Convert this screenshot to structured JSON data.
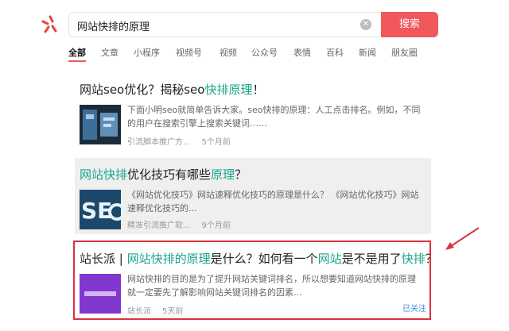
{
  "search": {
    "query": "网站快排的原理",
    "button_label": "搜索"
  },
  "tabs": [
    "全部",
    "文章",
    "小程序",
    "视频号",
    "视频",
    "公众号",
    "表情",
    "百科",
    "新闻",
    "朋友圈"
  ],
  "results": [
    {
      "title_plain_a": "网站seo优化？揭秘seo",
      "title_green": "快排原理",
      "title_plain_b": "！",
      "snippet": "下面小明seo就简单告诉大家。seo快排的原理：人工点击排名。例如，不同的用户在搜索引擎上搜索关键词……",
      "source": "引流脚本推广方...",
      "time": "5个月前"
    },
    {
      "title_a": "网站快排",
      "title_b": "优化技巧有哪些",
      "title_c": "原理",
      "title_d": "？",
      "snippet": "《网站优化技巧》网站速释优化技巧的原理是什么？ 《网站优化技巧》网站速释优化技巧的...",
      "source": "精准引流推广软...",
      "time": "9个月前"
    },
    {
      "title_a": "站长派 | ",
      "title_b": "网站快排的原理",
      "title_c": "是什么？如何看一个",
      "title_d": "网站",
      "title_e": "是不是用了",
      "title_f": "快排",
      "title_g": "？",
      "snippet": "网站快排的目的是为了提升网站关键词排名，所以想要知道网站快排的原理就一定要先了解影响网站关键词排名的因素...",
      "source": "站长派",
      "time": "5天前",
      "follow": "已关注"
    }
  ],
  "colors": {
    "accent": "#f0585b",
    "highlight": "#1aa58b",
    "annotation": "#d9333f"
  }
}
